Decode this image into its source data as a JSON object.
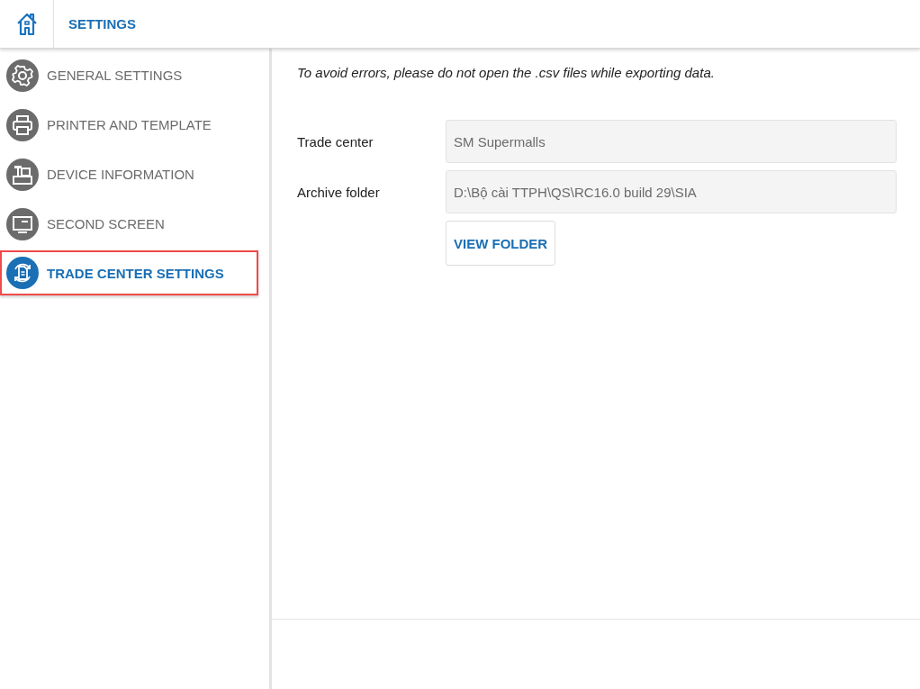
{
  "header": {
    "title": "SETTINGS"
  },
  "sidebar": {
    "items": [
      {
        "label": "GENERAL SETTINGS",
        "selected": false
      },
      {
        "label": "PRINTER AND TEMPLATE",
        "selected": false
      },
      {
        "label": "DEVICE INFORMATION",
        "selected": false
      },
      {
        "label": "SECOND SCREEN",
        "selected": false
      },
      {
        "label": "TRADE CENTER SETTINGS",
        "selected": true
      }
    ]
  },
  "content": {
    "notice": "To avoid errors, please do not open the .csv files while exporting data.",
    "fields": [
      {
        "label": "Trade center",
        "value": "SM Supermalls"
      },
      {
        "label": "Archive folder",
        "value": "D:\\Bộ cài TTPH\\QS\\RC16.0 build 29\\SIA"
      }
    ],
    "button": "VIEW FOLDER"
  }
}
